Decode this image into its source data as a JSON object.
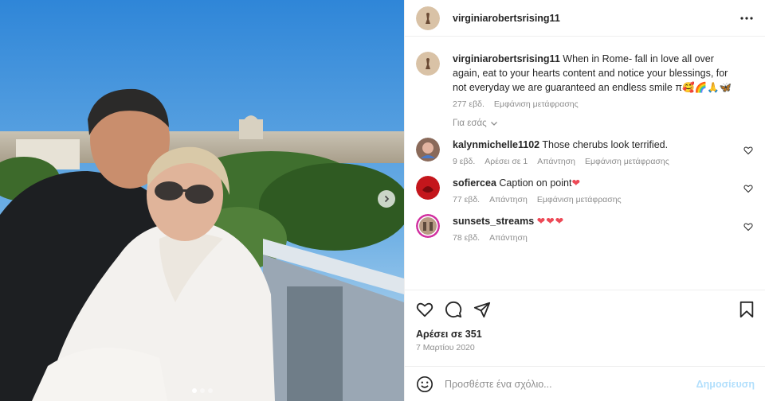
{
  "post": {
    "username": "virginiarobertsrising11",
    "caption": "When in Rome- fall in love all over again, eat to your hearts content and notice your blessings, for not everyday we are guaranteed an endless smile π🥰🌈🙏🦋",
    "caption_time": "277 εβδ.",
    "see_translation": "Εμφάνιση μετάφρασης",
    "for_you": "Για εσάς",
    "likes": "Αρέσει σε 351",
    "date": "7 Μαρτίου 2020",
    "add_comment_placeholder": "Προσθέστε ένα σχόλιο...",
    "post_button": "Δημοσίευση"
  },
  "comments": [
    {
      "username": "kalynmichelle1102",
      "text": "Those cherubs look terrified.",
      "time": "9 εβδ.",
      "likes": "Αρέσει σε 1",
      "reply": "Απάντηση",
      "translation": "Εμφάνιση μετάφρασης"
    },
    {
      "username": "sofiercea",
      "text": "Caption on point",
      "time": "77 εβδ.",
      "reply": "Απάντηση",
      "translation": "Εμφάνιση μετάφρασης"
    },
    {
      "username": "sunsets_streams",
      "text": "",
      "time": "78 εβδ.",
      "reply": "Απάντηση"
    }
  ],
  "icons": {
    "more": "more-horizontal-icon",
    "like": "heart-icon",
    "comment": "comment-icon",
    "share": "share-icon",
    "save": "bookmark-icon",
    "emoji": "emoji-icon",
    "next": "chevron-right-icon",
    "for_you": "chevron-down-icon"
  },
  "carousel": {
    "slides": 3,
    "active": 0
  },
  "colors": {
    "accent_blue": "#0095f6",
    "post_disabled": "#b2dffc",
    "heart_red": "#ed4956"
  }
}
